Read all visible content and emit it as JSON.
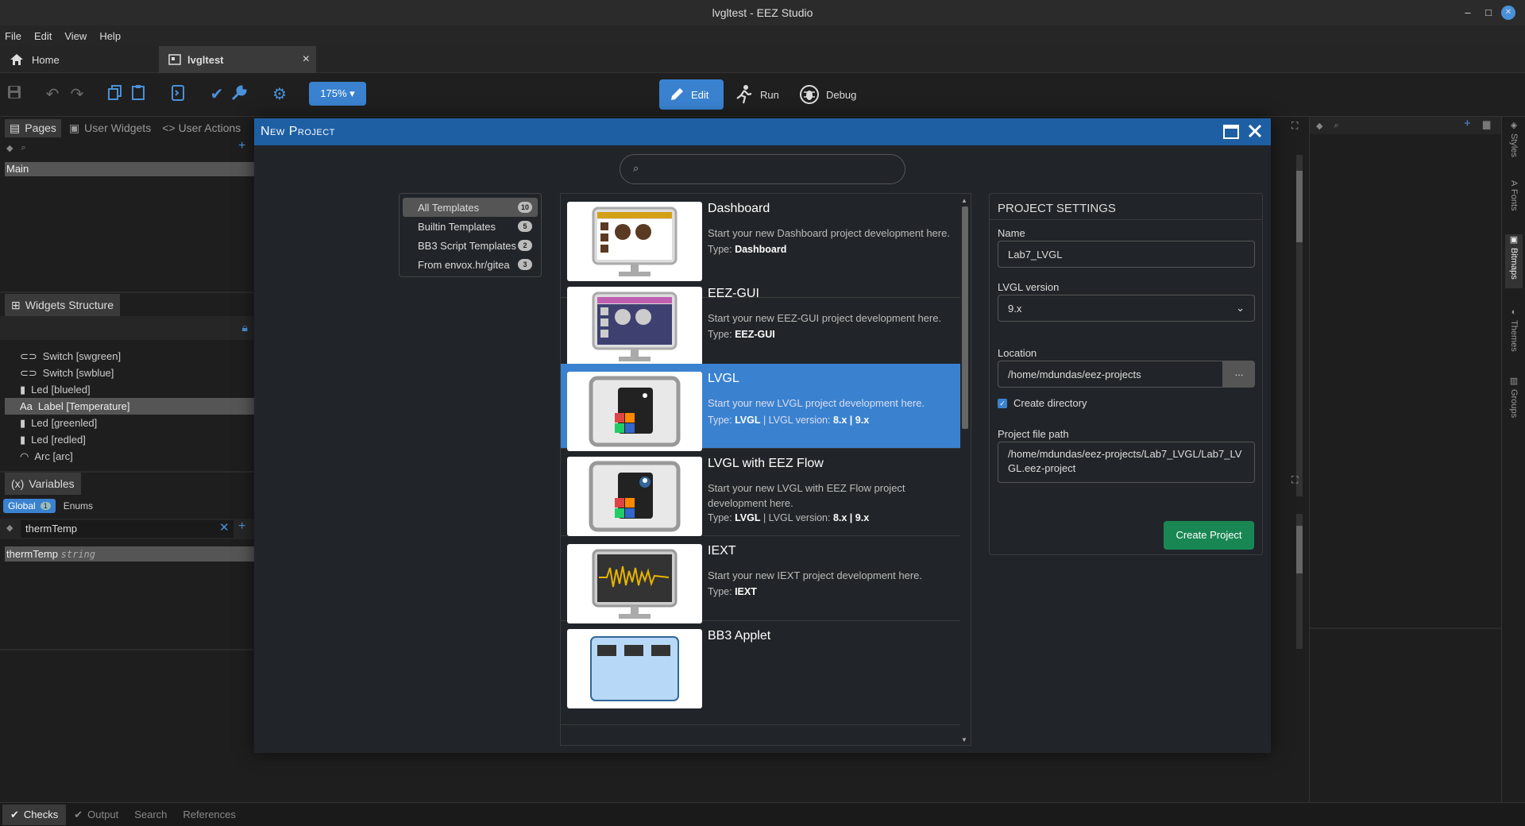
{
  "window": {
    "title": "lvgltest - EEZ Studio",
    "minimize": "–",
    "maximize": "□",
    "close": "✕"
  },
  "menu": [
    "File",
    "Edit",
    "View",
    "Help"
  ],
  "tabs": {
    "home_label": "Home",
    "project_label": "lvgltest",
    "close": "×"
  },
  "toolbar": {
    "zoom_label": "175%",
    "modes": [
      {
        "label": "Edit",
        "icon": "pencil-icon"
      },
      {
        "label": "Run",
        "icon": "run-icon"
      },
      {
        "label": "Debug",
        "icon": "bug-icon"
      }
    ]
  },
  "left_panel": {
    "tabs": [
      "Pages",
      "User Widgets",
      "User Actions"
    ],
    "pages": [
      "Main"
    ],
    "widgets_title": "Widgets Structure",
    "widgets": [
      {
        "label": "Switch [swgreen]",
        "icon": "switch-icon"
      },
      {
        "label": "Switch [swblue]",
        "icon": "switch-icon"
      },
      {
        "label": "Led [blueled]",
        "icon": "led-icon"
      },
      {
        "label": "Label [Temperature]",
        "icon": "label-icon"
      },
      {
        "label": "Led [greenled]",
        "icon": "led-icon"
      },
      {
        "label": "Led [redled]",
        "icon": "led-icon"
      },
      {
        "label": "Arc [arc]",
        "icon": "arc-icon"
      }
    ],
    "variables_title": "Variables",
    "variables_icon_text": "(x)",
    "var_tabs": [
      {
        "label": "Global",
        "count": "1"
      },
      {
        "label": "Enums"
      }
    ],
    "var_filter": "thermTemp",
    "variables": [
      {
        "name": "thermTemp",
        "type": "string"
      }
    ]
  },
  "modal": {
    "title": "New Project",
    "search_placeholder": "",
    "categories": [
      {
        "label": "All Templates",
        "count": "10"
      },
      {
        "label": "Builtin Templates",
        "count": "5"
      },
      {
        "label": "BB3 Script Templates",
        "count": "2"
      },
      {
        "label": "From envox.hr/gitea",
        "count": "3"
      }
    ],
    "templates": [
      {
        "name": "Dashboard",
        "desc": "Start your new Dashboard project development here.",
        "type_prefix": "Type:",
        "type": "Dashboard",
        "version_prefix": "",
        "version": ""
      },
      {
        "name": "EEZ-GUI",
        "desc": "Start your new EEZ-GUI project development here.",
        "type_prefix": "Type:",
        "type": "EEZ-GUI",
        "version_prefix": "",
        "version": ""
      },
      {
        "name": "LVGL",
        "desc": "Start your new LVGL project development here.",
        "type_prefix": "Type:",
        "type": "LVGL",
        "version_prefix": " | LVGL version: ",
        "version": "8.x | 9.x"
      },
      {
        "name": "LVGL with EEZ Flow",
        "desc": "Start your new LVGL with EEZ Flow project development here.",
        "type_prefix": "Type:",
        "type": "LVGL",
        "version_prefix": " | LVGL version: ",
        "version": "8.x | 9.x"
      },
      {
        "name": "IEXT",
        "desc": "Start your new IEXT project development here.",
        "type_prefix": "Type:",
        "type": "IEXT",
        "version_prefix": "",
        "version": ""
      },
      {
        "name": "BB3 Applet",
        "desc": "",
        "type_prefix": "",
        "type": "",
        "version_prefix": "",
        "version": ""
      }
    ],
    "settings": {
      "title": "PROJECT SETTINGS",
      "name_label": "Name",
      "name_value": "Lab7_LVGL",
      "version_label": "LVGL version",
      "version_value": "9.x",
      "location_label": "Location",
      "location_value": "/home/mdundas/eez-projects",
      "browse_label": "...",
      "create_dir_label": "Create directory",
      "path_label": "Project file path",
      "path_value": "/home/mdundas/eez-projects/Lab7_LVGL/Lab7_LVGL.eez-project",
      "create_label": "Create Project"
    }
  },
  "bottom_tabs": [
    "Checks",
    "Output",
    "Search",
    "References"
  ],
  "right_tabs": [
    "Styles",
    "Fonts",
    "Bitmaps",
    "Themes",
    "Groups"
  ],
  "colors": {
    "accent": "#3a82d0",
    "modal_header": "#1e5fa3",
    "create_button": "#198754"
  }
}
